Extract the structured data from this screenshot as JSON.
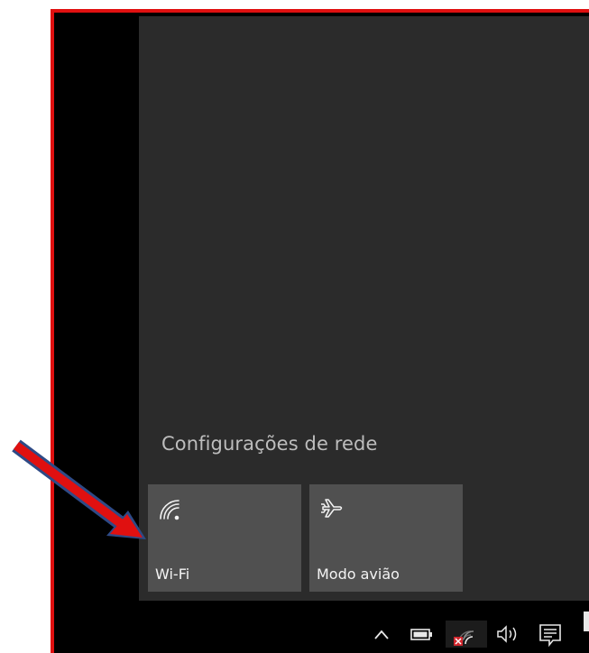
{
  "network_flyout": {
    "settings_link": "Configurações de rede",
    "tiles": [
      {
        "label": "Wi-Fi",
        "icon": "wifi-icon",
        "active": false
      },
      {
        "label": "Modo avião",
        "icon": "airplane-icon",
        "active": false
      }
    ]
  },
  "taskbar": {
    "tray_icons": [
      "chevron-up-icon",
      "battery-icon",
      "wifi-disconnected-icon",
      "speaker-icon",
      "action-center-icon"
    ]
  },
  "annotation": {
    "arrow_color": "#e01010",
    "frame_color": "#e01010"
  }
}
